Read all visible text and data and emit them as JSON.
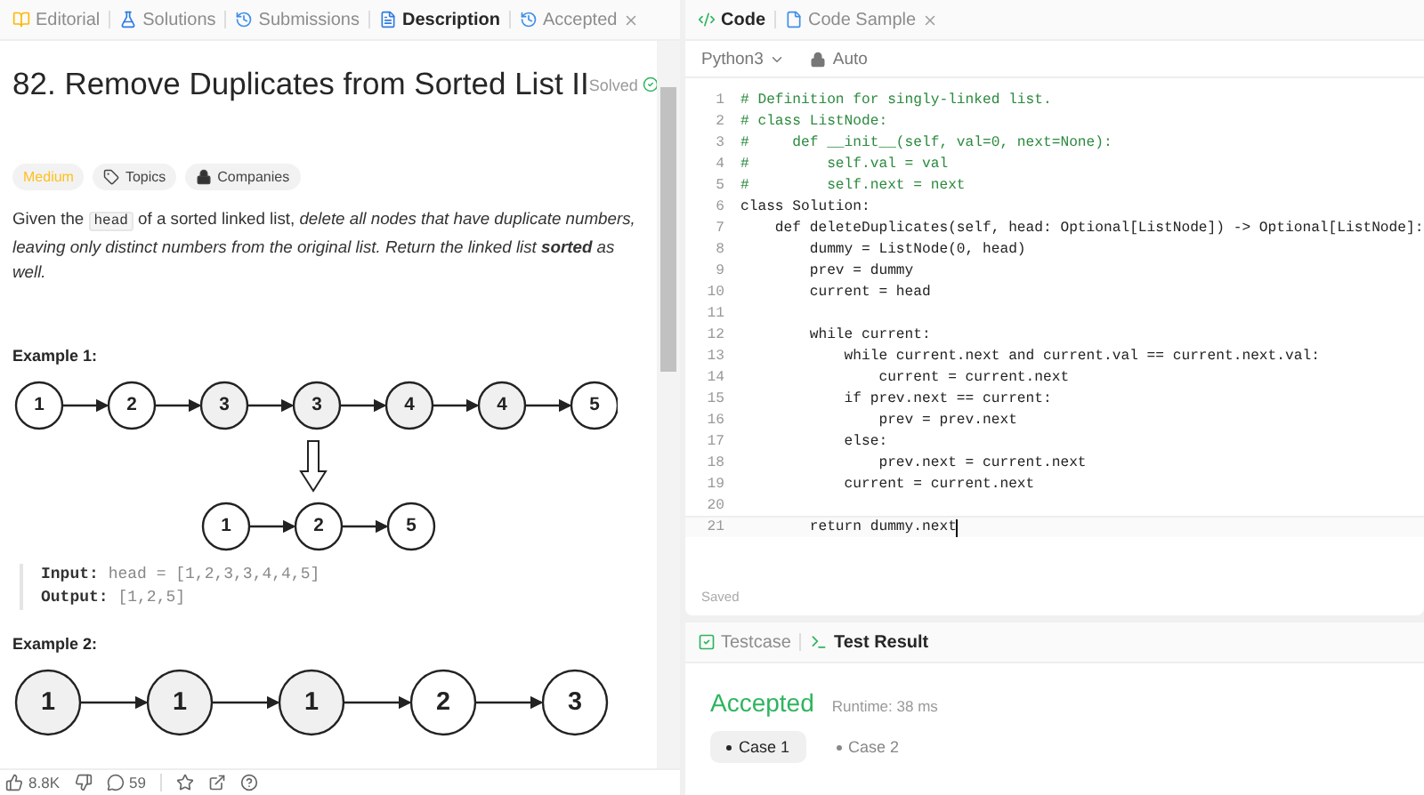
{
  "left_tabs": [
    {
      "label": "Editorial",
      "kind": "book",
      "selected": false
    },
    {
      "label": "Solutions",
      "kind": "flask",
      "selected": false
    },
    {
      "label": "Submissions",
      "kind": "history",
      "selected": false
    },
    {
      "label": "Description",
      "kind": "doc",
      "selected": true
    },
    {
      "label": "Accepted",
      "kind": "history",
      "selected": false,
      "closable": true
    }
  ],
  "problem": {
    "title": "82. Remove Duplicates from Sorted List II",
    "status": "Solved",
    "tags": [
      {
        "label": "Medium",
        "kind": "difficulty"
      },
      {
        "label": "Topics",
        "kind": "topics"
      },
      {
        "label": "Companies",
        "kind": "companies"
      }
    ],
    "description": [
      {
        "text": "Given the ",
        "kind": "plain"
      },
      {
        "text": "head",
        "kind": "code"
      },
      {
        "text": " of a sorted linked list, ",
        "kind": "plain"
      },
      {
        "text": "delete all nodes that have duplicate numbers, leaving only distinct numbers from the original list. Return the linked list **sorted** as well.",
        "kind": "italic"
      }
    ],
    "examples": [
      {
        "title": "Example 1:",
        "input_list": [
          {
            "value": "1",
            "duplicate": false
          },
          {
            "value": "2",
            "duplicate": false
          },
          {
            "value": "3",
            "duplicate": true
          },
          {
            "value": "3",
            "duplicate": true
          },
          {
            "value": "4",
            "duplicate": true
          },
          {
            "value": "4",
            "duplicate": true
          },
          {
            "value": "5",
            "duplicate": false
          }
        ],
        "output_list": [
          {
            "value": "1",
            "duplicate": false
          },
          {
            "value": "2",
            "duplicate": false
          },
          {
            "value": "5",
            "duplicate": false
          }
        ],
        "input_label": "Input:",
        "input": "head = [1,2,3,3,4,4,5]",
        "output_label": "Output:",
        "output": "[1,2,5]"
      },
      {
        "title": "Example 2:",
        "input_list": [
          {
            "value": "1",
            "duplicate": true
          },
          {
            "value": "1",
            "duplicate": true
          },
          {
            "value": "1",
            "duplicate": true
          },
          {
            "value": "2",
            "duplicate": false
          },
          {
            "value": "3",
            "duplicate": false
          }
        ]
      }
    ]
  },
  "footer": {
    "likes": "8.8K",
    "comments": "59"
  },
  "code_tabs": [
    {
      "label": "Code",
      "kind": "code",
      "selected": true
    },
    {
      "label": "Code Sample",
      "kind": "file",
      "selected": false,
      "closable": true
    }
  ],
  "language": "Python3",
  "mode": "Auto",
  "code": [
    {
      "n": "1",
      "text": "# Definition for singly-linked list.",
      "kind": "comment",
      "active": false
    },
    {
      "n": "2",
      "text": "# class ListNode:",
      "kind": "comment",
      "active": false
    },
    {
      "n": "3",
      "text": "#     def __init__(self, val=0, next=None):",
      "kind": "comment",
      "active": false
    },
    {
      "n": "4",
      "text": "#         self.val = val",
      "kind": "comment",
      "active": false
    },
    {
      "n": "5",
      "text": "#         self.next = next",
      "kind": "comment",
      "active": false
    },
    {
      "n": "6",
      "text": "class Solution:",
      "kind": "code",
      "active": false
    },
    {
      "n": "7",
      "text": "    def deleteDuplicates(self, head: Optional[ListNode]) -> Optional[ListNode]:",
      "kind": "code",
      "active": false
    },
    {
      "n": "8",
      "text": "        dummy = ListNode(0, head)",
      "kind": "code",
      "active": false
    },
    {
      "n": "9",
      "text": "        prev = dummy",
      "kind": "code",
      "active": false
    },
    {
      "n": "10",
      "text": "        current = head",
      "kind": "code",
      "active": false
    },
    {
      "n": "11",
      "active": false
    },
    {
      "n": "12",
      "text": "        while current:",
      "kind": "code",
      "active": false
    },
    {
      "n": "13",
      "text": "            while current.next and current.val == current.next.val:",
      "kind": "code",
      "active": false
    },
    {
      "n": "14",
      "text": "                current = current.next",
      "kind": "code",
      "active": false
    },
    {
      "n": "15",
      "text": "            if prev.next == current:",
      "kind": "code",
      "active": false
    },
    {
      "n": "16",
      "text": "                prev = prev.next",
      "kind": "code",
      "active": false
    },
    {
      "n": "17",
      "text": "            else:",
      "kind": "code",
      "active": false
    },
    {
      "n": "18",
      "text": "                prev.next = current.next",
      "kind": "code",
      "active": false
    },
    {
      "n": "19",
      "text": "            current = current.next",
      "kind": "code",
      "active": false
    },
    {
      "n": "20",
      "active": false
    },
    {
      "n": "21",
      "text": "        return dummy.next",
      "kind": "code",
      "active": true
    }
  ],
  "save_status": "Saved",
  "result_tabs": [
    {
      "label": "Testcase",
      "kind": "check",
      "selected": false
    },
    {
      "label": "Test Result",
      "kind": "terminal",
      "selected": true
    }
  ],
  "result": {
    "verdict": "Accepted",
    "runtime": "Runtime: 38 ms",
    "cases": [
      {
        "label": "Case 1",
        "selected": true
      },
      {
        "label": "Case 2",
        "selected": false
      }
    ]
  }
}
